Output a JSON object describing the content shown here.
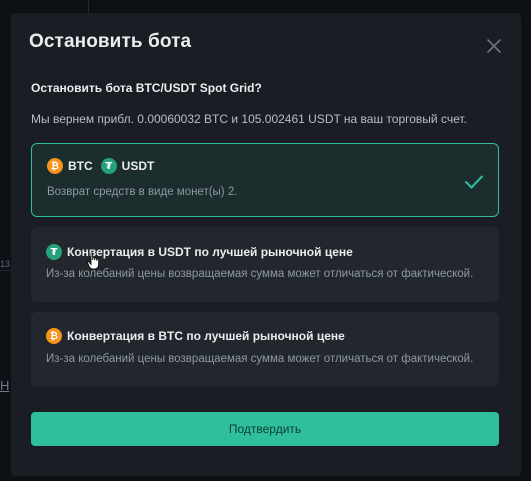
{
  "background": {
    "side_number": "13",
    "side_link": "Н"
  },
  "modal": {
    "title": "Остановить бота",
    "close_icon": "close-icon",
    "question": "Остановить бота BTC/USDT Spot Grid?",
    "refund_text": "Мы вернем прибл. 0.00060032 BTC и 105.002461 USDT на ваш торговый счет.",
    "options": [
      {
        "selected": true,
        "coins": [
          "BTC",
          "USDT"
        ],
        "description": "Возврат средств в виде монет(ы) 2."
      },
      {
        "selected": false,
        "label": "Конвертация в USDT по лучшей рыночной цене",
        "description": "Из-за колебаний цены возвращаемая сумма может отличаться от фактической."
      },
      {
        "selected": false,
        "label": "Конвертация в BTC по лучшей рыночной цене",
        "description": "Из-за колебаний цены возвращаемая сумма может отличаться от фактической."
      }
    ],
    "confirm_label": "Подтвердить"
  },
  "colors": {
    "accent": "#2fbf9d",
    "modal_bg": "#1a1e24",
    "card_bg": "#22272e",
    "btc": "#f7931a",
    "usdt": "#26a17b"
  }
}
